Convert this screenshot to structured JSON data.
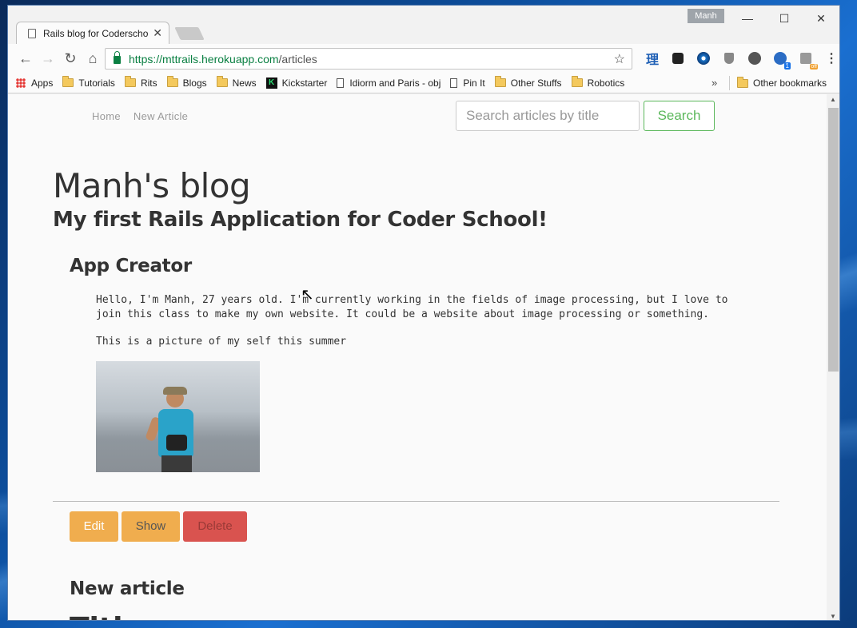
{
  "browser": {
    "tab_title": "Rails blog for Coderscho",
    "profile_name": "Manh",
    "url_host": "https://mttrails.herokuapp.com",
    "url_path": "/articles",
    "extension_ri": "理"
  },
  "bookmarks": {
    "items": [
      {
        "label": "Apps",
        "icon": "apps-grid-icon"
      },
      {
        "label": "Tutorials",
        "icon": "folder-icon"
      },
      {
        "label": "Rits",
        "icon": "folder-icon"
      },
      {
        "label": "Blogs",
        "icon": "folder-icon"
      },
      {
        "label": "News",
        "icon": "folder-icon"
      },
      {
        "label": "Kickstarter",
        "icon": "kickstarter-icon"
      },
      {
        "label": "Idiorm and Paris - obj",
        "icon": "page-icon"
      },
      {
        "label": "Pin It",
        "icon": "page-icon"
      },
      {
        "label": "Other Stuffs",
        "icon": "folder-icon"
      },
      {
        "label": "Robotics",
        "icon": "folder-icon"
      }
    ],
    "more": "»",
    "other": "Other bookmarks"
  },
  "page": {
    "nav": {
      "home": "Home",
      "new_article": "New Article"
    },
    "search": {
      "placeholder": "Search articles by title",
      "button": "Search"
    },
    "blog_title": "Manh's blog",
    "subtitle": "My first Rails Application for Coder School!",
    "section_title": "App Creator",
    "paragraph1": "Hello, I'm Manh, 27 years old. I'm currently working in the fields of image processing, but I love to join this class to make my own website. It could be a website about image processing or something.",
    "paragraph2": "This is a picture of my self this summer",
    "buttons": {
      "edit": "Edit",
      "show": "Show",
      "delete": "Delete"
    },
    "new_article_title": "New article",
    "form_title_label": "Title"
  },
  "colors": {
    "success": "#5cb85c",
    "warning": "#f0ad4e",
    "danger": "#d9534f",
    "url_secure": "#0b8043"
  }
}
